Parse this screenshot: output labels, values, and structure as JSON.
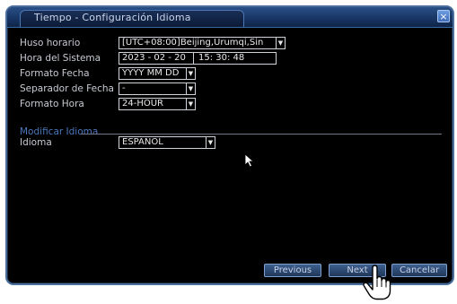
{
  "window": {
    "title": "Tiempo - Configuración Idioma",
    "close_label": "×"
  },
  "form": {
    "timezone": {
      "label": "Huso horario",
      "value": "[UTC+08:00]Beijing,Urumqi,Sin"
    },
    "system_time": {
      "label": "Hora del Sistema",
      "date_value": "2023 - 02 - 20",
      "time_value": "15: 30: 48"
    },
    "date_format": {
      "label": "Formato Fecha",
      "value": "YYYY MM DD"
    },
    "date_separator": {
      "label": "Separador de Fecha",
      "value": "-"
    },
    "time_format": {
      "label": "Formato Hora",
      "value": "24-HOUR"
    }
  },
  "language_section": {
    "heading": "Modificar Idioma",
    "language": {
      "label": "Idioma",
      "value": "ESPAÑOL"
    }
  },
  "buttons": {
    "previous": "Previous",
    "next": "Next",
    "cancel": "Cancelar"
  },
  "icons": {
    "dropdown": "chevron-down-icon",
    "pointer": "arrow-cursor-icon",
    "hand": "hand-pointer-icon"
  },
  "colors": {
    "title_bar": "#173563",
    "section_heading": "#4a77bb",
    "background": "#000000"
  }
}
